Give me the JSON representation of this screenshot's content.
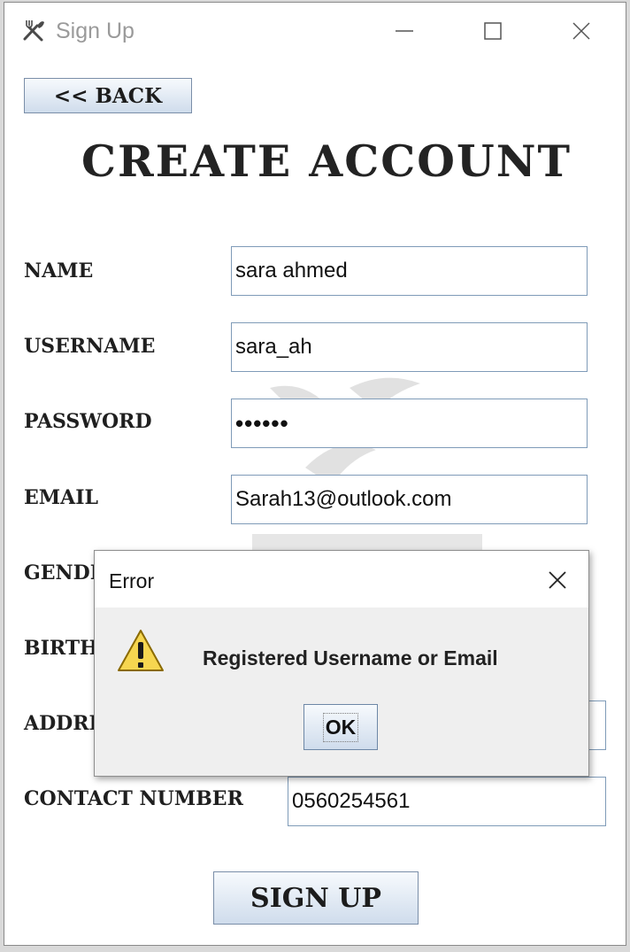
{
  "window": {
    "title": "Sign Up",
    "controls": {
      "minimize": "minimize",
      "maximize": "maximize",
      "close": "close"
    }
  },
  "header": {
    "back_label": "<< BACK",
    "title": "CREATE ACCOUNT"
  },
  "form": {
    "name": {
      "label": "NAME",
      "value": "sara ahmed"
    },
    "username": {
      "label": "USERNAME",
      "value": "sara_ah"
    },
    "password": {
      "label": "PASSWORD",
      "value": "••••••"
    },
    "email": {
      "label": "EMAIL",
      "value": "Sarah13@outlook.com"
    },
    "gender": {
      "label": "GENDER"
    },
    "birth": {
      "label": "BIRTHDATE"
    },
    "address": {
      "label": "ADDRESS"
    },
    "contact": {
      "label": "CONTACT NUMBER",
      "value": "0560254561"
    }
  },
  "signup_label": "SIGN UP",
  "dialog": {
    "title": "Error",
    "message": "Registered Username or Email",
    "ok_label": "OK",
    "icon": "warning-icon"
  },
  "colors": {
    "field_border": "#7f9bb8",
    "button_top": "#f7fafd",
    "button_bottom": "#cfdcec",
    "warning_fill": "#f6d650"
  }
}
